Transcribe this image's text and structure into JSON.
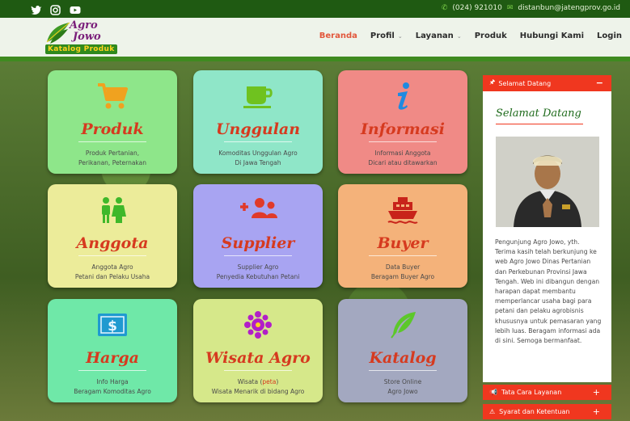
{
  "topbar": {
    "social_icons": [
      "twitter-icon",
      "instagram-icon",
      "youtube-icon"
    ],
    "phone": "(024) 921010",
    "email": "distanbun@jatengprov.go.id"
  },
  "logo": {
    "line1": "Agro",
    "line2": "Jowo",
    "badge": "Katalog Produk"
  },
  "nav": {
    "items": [
      {
        "label": "Beranda",
        "active": true
      },
      {
        "label": "Profil",
        "dropdown": true
      },
      {
        "label": "Layanan",
        "dropdown": true
      },
      {
        "label": "Produk"
      },
      {
        "label": "Hubungi Kami"
      },
      {
        "label": "Login"
      }
    ]
  },
  "tiles": [
    {
      "title": "Produk",
      "line1": "Produk Pertanian,",
      "line2": "Perikanan, Peternakan",
      "icon": "shopping-cart-icon",
      "color": "#8ee68a"
    },
    {
      "title": "Unggulan",
      "line1": "Komoditas Unggulan Agro",
      "line2": "Di Jawa Tengah",
      "icon": "coffee-cup-icon",
      "color": "#8fe6c8"
    },
    {
      "title": "Informasi",
      "line1": "Informasi Anggota",
      "line2": "Dicari atau ditawarkan",
      "icon": "info-icon",
      "color": "#f08a86"
    },
    {
      "title": "Anggota",
      "line1": "Anggota Agro",
      "line2": "Petani dan Pelaku Usaha",
      "icon": "people-icon",
      "color": "#ecec9a"
    },
    {
      "title": "Supplier",
      "line1": "Supplier Agro",
      "line2": "Penyedia Kebutuhan Petani",
      "icon": "add-group-icon",
      "color": "#a8a4f2"
    },
    {
      "title": "Buyer",
      "line1": "Data Buyer",
      "line2": "Beragam Buyer Agro",
      "icon": "ship-icon",
      "color": "#f4b27a"
    },
    {
      "title": "Harga",
      "line1": "Info Harga",
      "line2": "Beragam Komoditas Agro",
      "icon": "money-icon",
      "color": "#6fe8a8"
    },
    {
      "title": "Wisata Agro",
      "line1_pre": "Wisata (",
      "line1_link": "peta",
      "line1_post": ")",
      "line2": "Wisata Menarik di bidang Agro",
      "icon": "flower-icon",
      "color": "#d6e88a"
    },
    {
      "title": "Katalog",
      "line1": "Store Online",
      "line2": "Agro Jowo",
      "icon": "feather-icon",
      "color": "#a3a8c0"
    }
  ],
  "sidebar": {
    "header": "Selamat Datang",
    "title": "Selamat Datang",
    "text": "Pengunjung Agro Jowo, yth. Terima kasih telah berkunjung ke web Agro Jowo Dinas Pertanian dan Perkebunan Provinsi Jawa Tengah. Web ini dibangun dengan harapan dapat membantu memperlancar usaha bagi para petani dan pelaku agrobisnis khususnya untuk pemasaran yang lebih luas. Beragam informasi ada di sini. Semoga bermanfaat.",
    "bar1": "Tata Cara Layanan",
    "bar2": "Syarat dan Ketentuan"
  },
  "colors": {
    "accent": "#f0371f",
    "title": "#d63a1f",
    "topbar": "#1f5a12",
    "nav_active": "#e2573c"
  }
}
